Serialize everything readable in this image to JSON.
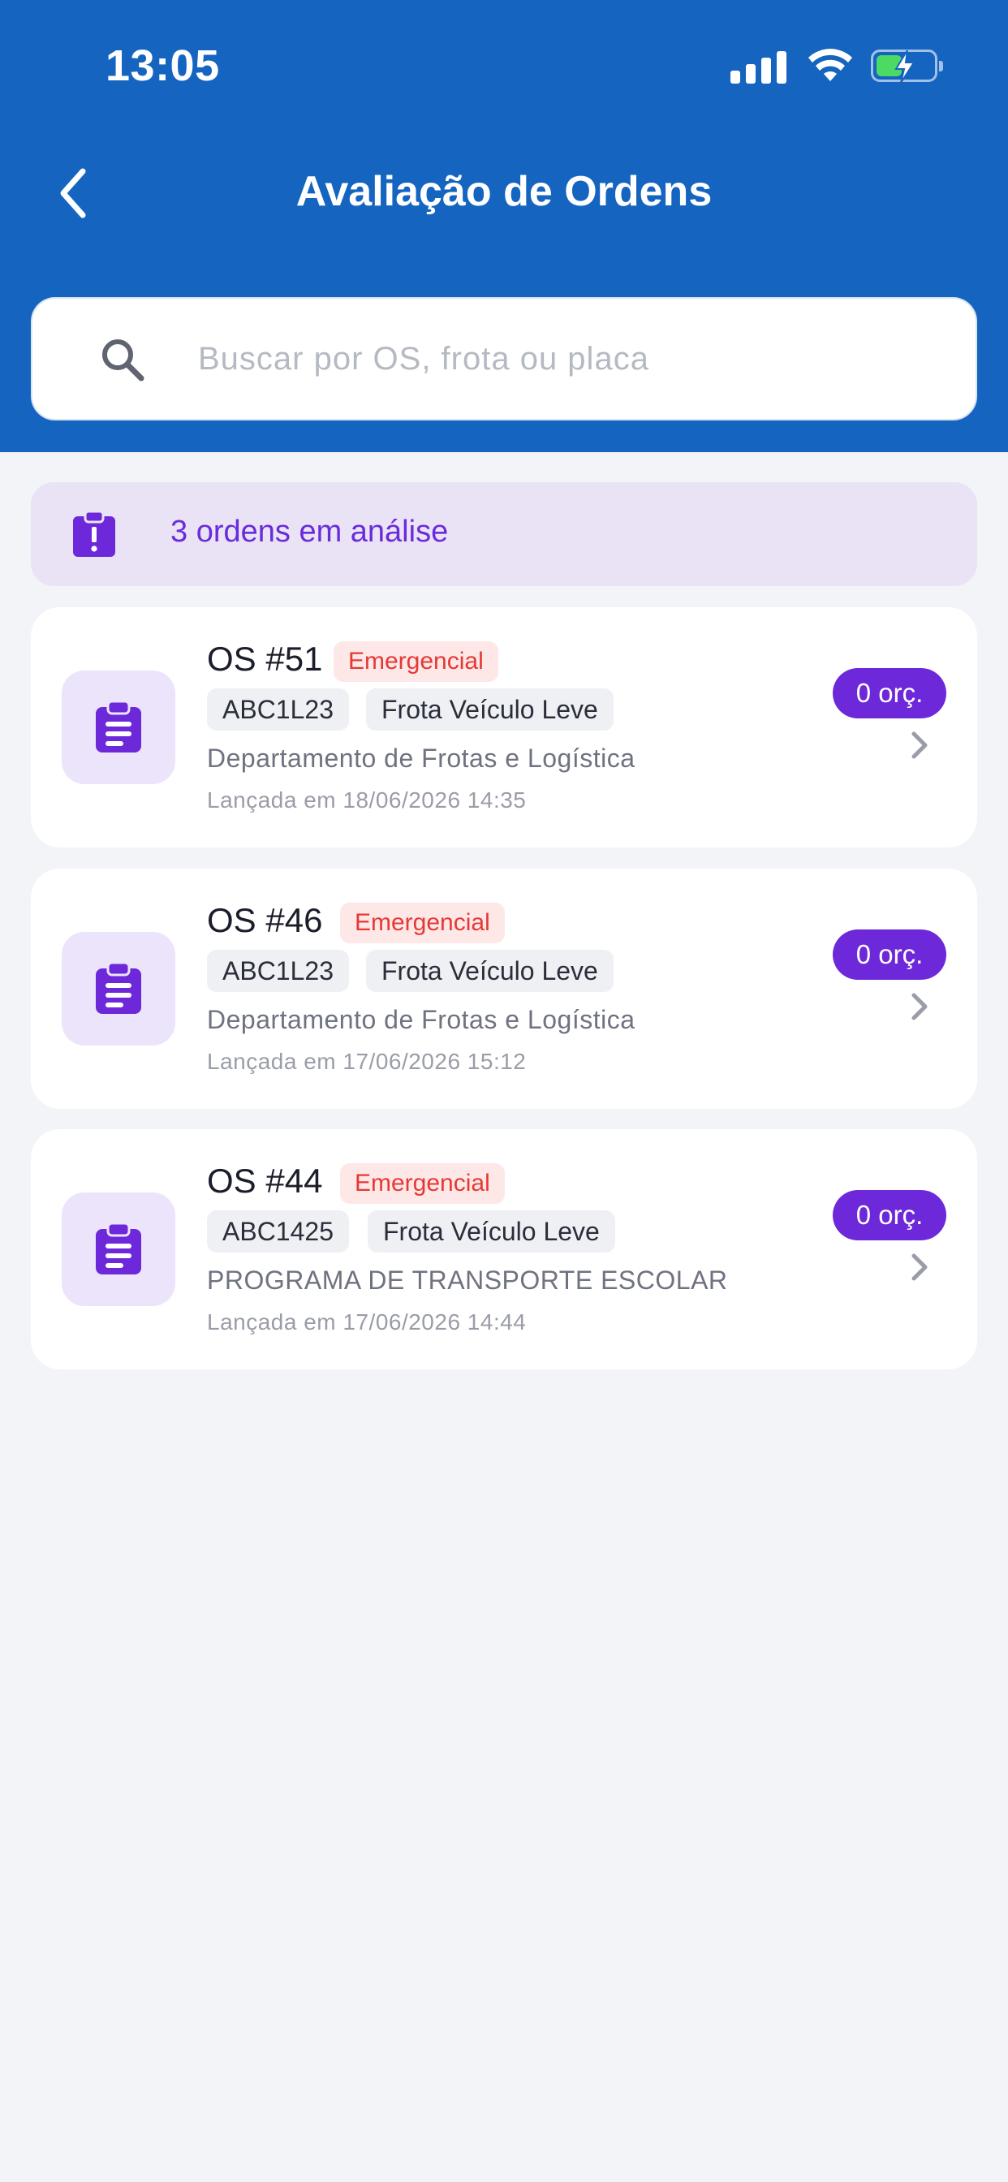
{
  "status_bar": {
    "time": "13:05"
  },
  "header": {
    "title": "Avaliação de Ordens"
  },
  "search": {
    "placeholder": "Buscar por OS, frota ou placa",
    "value": ""
  },
  "summary": {
    "text": "3 ordens em análise"
  },
  "orders": [
    {
      "number": "OS #51",
      "priority": "Emergencial",
      "plate": "ABC1L23",
      "fleet": "Frota Veículo Leve",
      "department": "Departamento de Frotas e Logística",
      "launched": "Lançada em 18/06/2026 14:35",
      "quotes": "0 orç."
    },
    {
      "number": "OS #46",
      "priority": "Emergencial",
      "plate": "ABC1L23",
      "fleet": "Frota Veículo Leve",
      "department": "Departamento de Frotas e Logística",
      "launched": "Lançada em 17/06/2026 15:12",
      "quotes": "0 orç."
    },
    {
      "number": "OS #44",
      "priority": "Emergencial",
      "plate": "ABC1425",
      "fleet": "Frota Veículo Leve",
      "department": "PROGRAMA DE TRANSPORTE ESCOLAR",
      "launched": "Lançada em 17/06/2026 14:44",
      "quotes": "0 orç."
    }
  ],
  "colors": {
    "header_bg": "#1565c0",
    "accent_purple": "#6d28d9",
    "emergency_red": "#e53935",
    "page_bg": "#f3f4f8"
  },
  "icons": {
    "back": "chevron-left-icon",
    "search": "search-icon",
    "summary": "clipboard-alert-icon",
    "card": "clipboard-list-icon",
    "card_open": "chevron-right-icon"
  }
}
